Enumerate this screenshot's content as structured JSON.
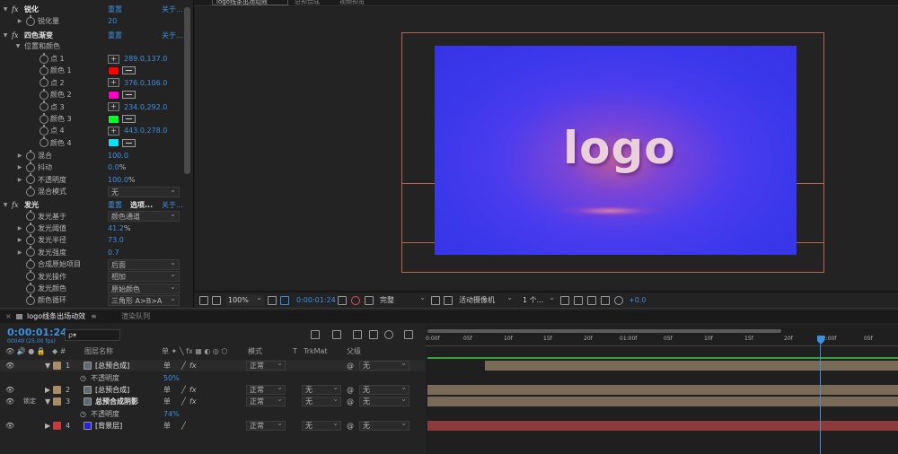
{
  "viewer_tabs": [
    "logo线条出场动效",
    "总预合成",
    "视频预览"
  ],
  "effect_controls": {
    "fx1": {
      "name": "锐化",
      "reset": "重置",
      "about": "关于..."
    },
    "sharpen_amount": {
      "label": "锐化量",
      "value": "20"
    },
    "fx2": {
      "name": "四色渐变",
      "reset": "重置",
      "about": "关于..."
    },
    "group_pos_color": "位置和颜色",
    "points": [
      {
        "point_label": "点 1",
        "point_value": "289.0,137.0",
        "color_label": "颜色 1",
        "color": "#ff0000"
      },
      {
        "point_label": "点 2",
        "point_value": "376.0,106.0",
        "color_label": "颜色 2",
        "color": "#ff00c8"
      },
      {
        "point_label": "点 3",
        "point_value": "234.0,292.0",
        "color_label": "颜色 3",
        "color": "#00ff22"
      },
      {
        "point_label": "点 4",
        "point_value": "443.0,278.0",
        "color_label": "颜色 4",
        "color": "#00e6ff"
      }
    ],
    "blend": {
      "label": "混合",
      "value": "100.0"
    },
    "jitter": {
      "label": "抖动",
      "value": "0.0",
      "unit": "%"
    },
    "opacity": {
      "label": "不透明度",
      "value": "100.0",
      "unit": "%"
    },
    "blend_mode": {
      "label": "混合模式",
      "value": "无"
    },
    "fx3": {
      "name": "发光",
      "reset": "重置",
      "options": "选项...",
      "about": "关于..."
    },
    "glow_based_on": {
      "label": "发光基于",
      "value": "颜色通道"
    },
    "glow_threshold": {
      "label": "发光阈值",
      "value": "41.2",
      "unit": "%"
    },
    "glow_radius": {
      "label": "发光半径",
      "value": "73.0"
    },
    "glow_intensity": {
      "label": "发光强度",
      "value": "0.7"
    },
    "composite_original": {
      "label": "合成原始项目",
      "value": "后面"
    },
    "glow_operation": {
      "label": "发光操作",
      "value": "相加"
    },
    "glow_colors": {
      "label": "发光颜色",
      "value": "原始颜色"
    },
    "color_looping": {
      "label": "颜色循环",
      "value": "三角形 A>B>A"
    }
  },
  "viewer": {
    "logo_text": "logo",
    "zoom": "100%",
    "timecode": "0:00:01:24",
    "resolution": "完整",
    "camera": "活动摄像机",
    "views": "1 个...",
    "exposure": "+0.0"
  },
  "timeline": {
    "tab_comp": "logo线条出场动效",
    "tab_render": "渲染队列",
    "timecode": "0:00:01:24",
    "frame_info": "00049 (25.00 fps)",
    "search_placeholder": "ρ▾",
    "col_layer_name": "图层名称",
    "col_mode": "模式",
    "col_t": "T",
    "col_trkmat": "TrkMat",
    "col_parent": "父级",
    "ruler_labels": [
      "0:00f",
      "05f",
      "10f",
      "15f",
      "20f",
      "01:00f",
      "05f",
      "10f",
      "15f",
      "20f",
      "02:00f",
      "05f"
    ],
    "layers": [
      {
        "num": "1",
        "name": "[总预合成]",
        "mode": "正常",
        "trkmat": "",
        "parent": "无",
        "label_color": "#a88d66",
        "sub_label": "不透明度",
        "sub_value": "50%"
      },
      {
        "num": "2",
        "name": "[总预合成]",
        "mode": "正常",
        "trkmat": "无",
        "parent": "无",
        "label_color": "#a88d66"
      },
      {
        "num": "3",
        "name": "总预合成阴影",
        "mode": "正常",
        "trkmat": "无",
        "parent": "无",
        "label_color": "#a88d66",
        "sub_label": "不透明度",
        "sub_value": "74%",
        "switch_text": "锁定"
      },
      {
        "num": "4",
        "name": "[背景层]",
        "mode": "正常",
        "trkmat": "无",
        "parent": "无",
        "label_color": "#c33b3b"
      }
    ]
  }
}
